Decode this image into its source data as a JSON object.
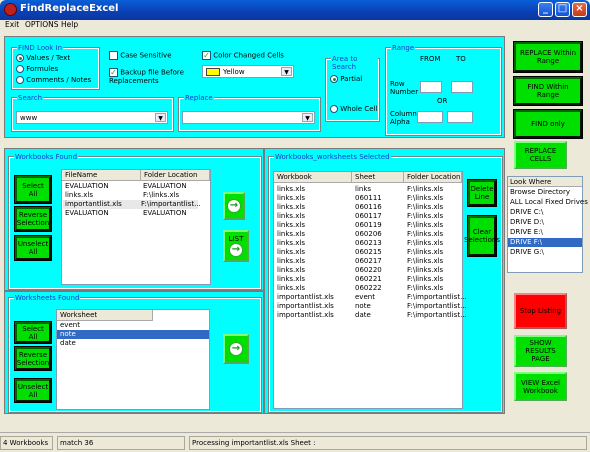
{
  "window": {
    "title": "FindReplaceExcel"
  },
  "menu": [
    "Exit",
    "OPTIONS",
    "Help"
  ],
  "find_look_in": {
    "label": "FIND Look In",
    "options": [
      "Values / Text",
      "Formules",
      "Comments / Notes"
    ],
    "selected": 0
  },
  "case_sensitive": {
    "label": "Case Sensitive",
    "checked": false
  },
  "backup": {
    "label": "Backup file Before Replacements",
    "checked": true
  },
  "color_changed": {
    "label": "Color Changed Cells",
    "checked": true,
    "color_value": "Yellow",
    "swatch": "#ffff00"
  },
  "area": {
    "label": "Area to Search",
    "options": [
      "Partial",
      "Whole Cell"
    ],
    "selected": 0
  },
  "range": {
    "label": "Range",
    "from": "FROM",
    "to": "TO",
    "row_number": "Row Number",
    "or": "OR",
    "column_alpha": "Column Alpha"
  },
  "search": {
    "label": "Search",
    "value": "www"
  },
  "replace": {
    "label": "Replace",
    "value": ""
  },
  "right_buttons": {
    "replace_within_range": "REPLACE Within Range",
    "find_within_range": "FIND Within Range",
    "find_only": "FIND only",
    "replace_cells": "REPLACE CELLS"
  },
  "look_where": {
    "header": "Look Where",
    "items": [
      "Browse Directory",
      "ALL Local Fixed Drives",
      "DRIVE C:\\",
      "DRIVE D:\\",
      "DRIVE E:\\",
      "DRIVE F:\\",
      "DRIVE G:\\"
    ],
    "selected": 5
  },
  "bottom_right_buttons": {
    "stop": "Stop Listing",
    "show_results": "SHOW RESULTS PAGE",
    "view_excel": "VIEW Excel Workbook"
  },
  "workbooks_found": {
    "label": "Workbooks Found",
    "columns": [
      "FileName",
      "Folder Location"
    ],
    "rows": [
      [
        "EVALUATION",
        "EVALUATION"
      ],
      [
        "links.xls",
        "F:\\links.xls"
      ],
      [
        "importantlist.xls",
        "F:\\importantlist..."
      ],
      [
        "EVALUATION",
        "EVALUATION"
      ]
    ],
    "selected": 2,
    "buttons": [
      "Select All",
      "Reverse Selection",
      "Unselect All"
    ],
    "list_button": "LIST"
  },
  "worksheets_found": {
    "label": "Worksheets Found",
    "columns": [
      "Worksheet"
    ],
    "rows": [
      "event",
      "note",
      "date"
    ],
    "selected": 1,
    "buttons": [
      "Select All",
      "Reverse Selection",
      "Unselect All"
    ]
  },
  "selected_sheets": {
    "label": "Workbooks_worksheets Selected",
    "columns": [
      "Workbook",
      "Sheet",
      "Folder Location"
    ],
    "rows": [
      [
        "links.xls",
        "links",
        "F:\\links.xls"
      ],
      [
        "links.xls",
        "060111",
        "F:\\links.xls"
      ],
      [
        "links.xls",
        "060116",
        "F:\\links.xls"
      ],
      [
        "links.xls",
        "060117",
        "F:\\links.xls"
      ],
      [
        "links.xls",
        "060119",
        "F:\\links.xls"
      ],
      [
        "links.xls",
        "060206",
        "F:\\links.xls"
      ],
      [
        "links.xls",
        "060213",
        "F:\\links.xls"
      ],
      [
        "links.xls",
        "060215",
        "F:\\links.xls"
      ],
      [
        "links.xls",
        "060217",
        "F:\\links.xls"
      ],
      [
        "links.xls",
        "060220",
        "F:\\links.xls"
      ],
      [
        "links.xls",
        "060221",
        "F:\\links.xls"
      ],
      [
        "links.xls",
        "060222",
        "F:\\links.xls"
      ],
      [
        "importantlist.xls",
        "event",
        "F:\\importantlist..."
      ],
      [
        "importantlist.xls",
        "note",
        "F:\\importantlist..."
      ],
      [
        "importantlist.xls",
        "date",
        "F:\\importantlist..."
      ]
    ],
    "delete_button": "Delete Line",
    "clear_button": "Clear Selections"
  },
  "status": {
    "workbooks": "4 Workbooks",
    "match": "match 36",
    "processing": "Processing importantlist.xls Sheet :"
  },
  "colors": {
    "panel": "#00ffff",
    "button_green": "#00e000",
    "stop_red": "#ff0000",
    "selection": "#316ac5"
  }
}
